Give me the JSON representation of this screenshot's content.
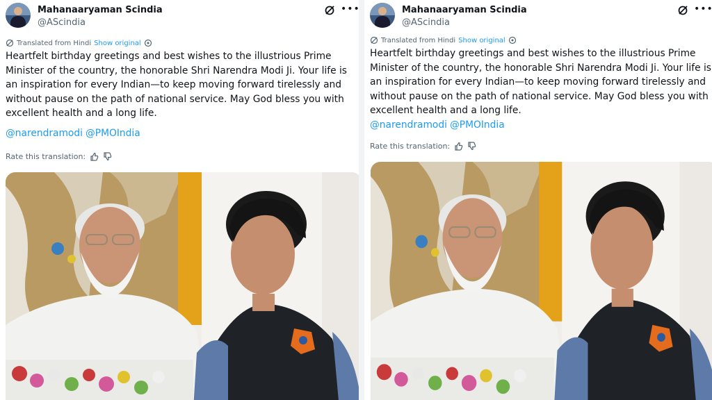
{
  "tweet": {
    "author_name": "Mahanaaryaman Scindia",
    "author_handle": "@AScindia",
    "translation_label": "Translated from Hindi",
    "show_original_label": "Show original",
    "text_lines_left": [
      "Heartfelt birthday greetings and best wishes to the illustrious Prime",
      "Minister of the country, the honorable Shri Narendra Modi Ji. Your life is",
      "an inspiration for every Indian—to keep moving forward tirelessly and",
      "without pause on the path of national service. May God bless you with",
      "excellent health and a long life."
    ],
    "text_lines_right": [
      "Heartfelt birthday greetings and best wishes to the illustrious Prime",
      "Minister of the country, the honorable Shri Narendra Modi Ji. Your life is",
      "an inspiration for every Indian—to keep moving forward tirelessly and",
      "without pause on the path of national service. May God bless you with",
      "excellent health and a long life."
    ],
    "mentions": [
      "@narendramodi",
      "@PMOIndia"
    ],
    "rate_label": "Rate this translation:"
  },
  "icons": {
    "grok": "grok-icon",
    "more": "more-options-icon",
    "translate": "translate-icon",
    "info": "info-icon",
    "thumbs_up": "thumbs-up-icon",
    "thumbs_down": "thumbs-down-icon"
  },
  "colors": {
    "link": "#1d9bf0",
    "secondary_text": "#536471",
    "primary_text": "#0f1419"
  }
}
